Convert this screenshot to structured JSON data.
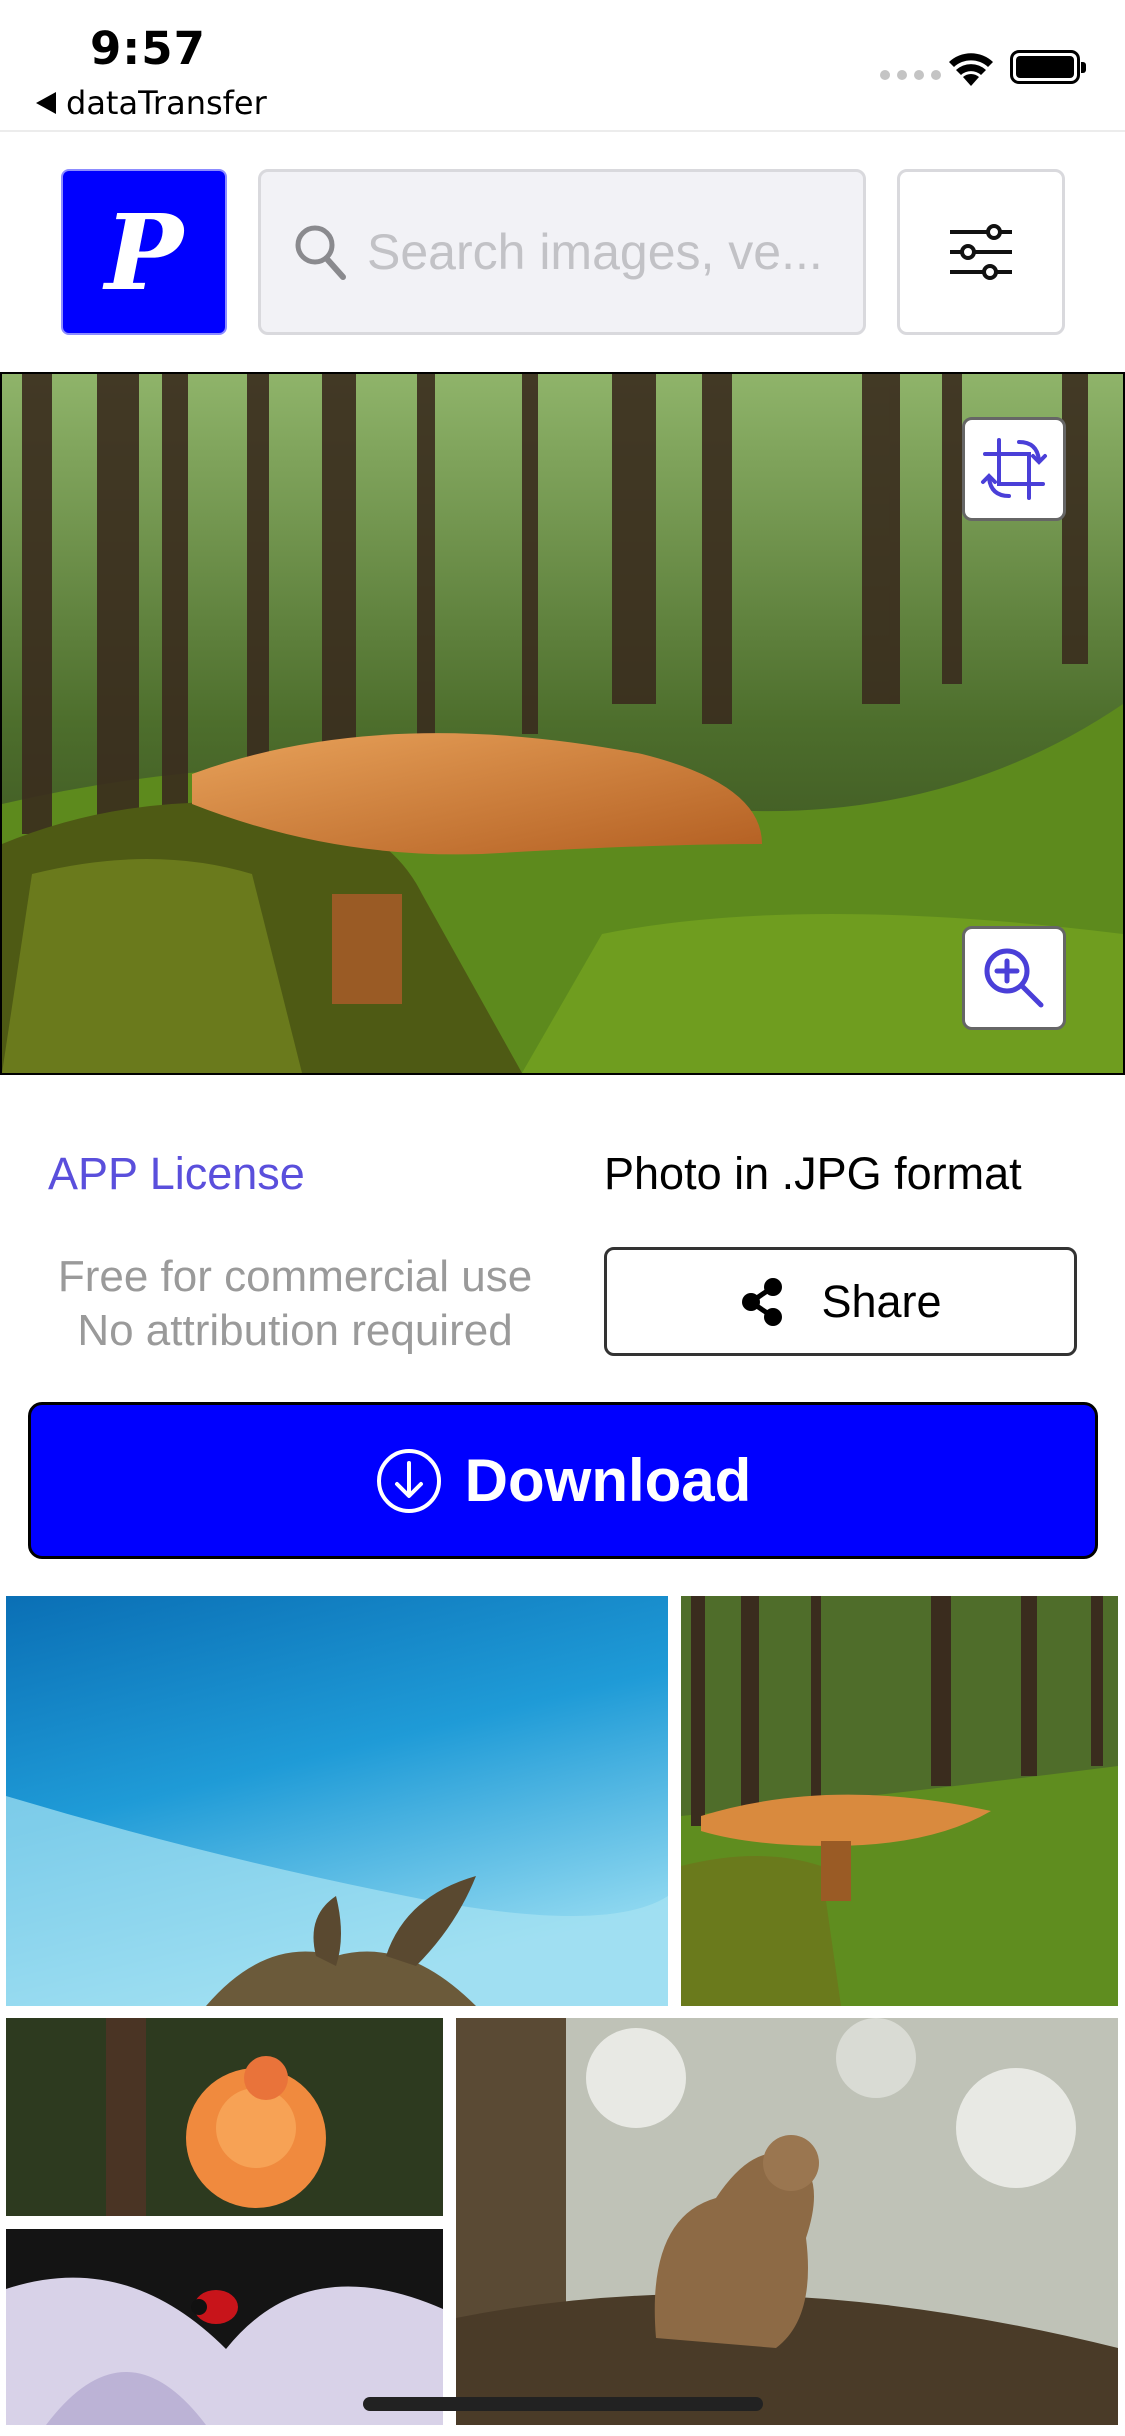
{
  "status_bar": {
    "time": "9:57",
    "back_app": "dataTransfer"
  },
  "header": {
    "logo_letter": "P",
    "search_placeholder": "Search images, ve..."
  },
  "info": {
    "license_label": "APP License",
    "format_label": "Photo in .JPG format",
    "usage_line1": "Free for commercial use",
    "usage_line2": "No attribution required",
    "share_label": "Share"
  },
  "download_label": "Download",
  "colors": {
    "accent": "#0000ff",
    "link": "#5a4fdc",
    "icon": "#4a3fd8"
  },
  "icons": [
    "crop-rotate-icon",
    "zoom-in-icon",
    "search-icon",
    "sliders-icon",
    "share-icon",
    "download-circle-icon"
  ]
}
